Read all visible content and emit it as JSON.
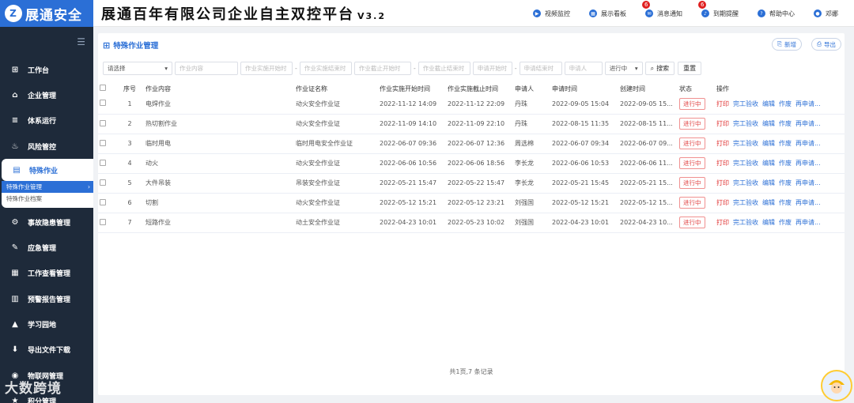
{
  "app": {
    "logo_text": "展通安全",
    "title": "展通百年有限公司企业自主双控平台",
    "version": "V3.2"
  },
  "topnav": [
    {
      "label": "视频监控",
      "icon": "video-icon",
      "badge": ""
    },
    {
      "label": "展示看板",
      "icon": "dashboard-icon",
      "badge": ""
    },
    {
      "label": "消息通知",
      "icon": "message-icon",
      "badge": "6"
    },
    {
      "label": "到期提醒",
      "icon": "bell-icon",
      "badge": "6"
    },
    {
      "label": "帮助中心",
      "icon": "help-icon",
      "badge": ""
    },
    {
      "label": "邓娜",
      "icon": "user-icon",
      "badge": ""
    }
  ],
  "sidebar": {
    "items": [
      {
        "label": "工作台",
        "icon": "windows-icon"
      },
      {
        "label": "企业管理",
        "icon": "home-icon"
      },
      {
        "label": "体系运行",
        "icon": "stack-icon"
      },
      {
        "label": "风险管控",
        "icon": "fire-icon"
      },
      {
        "label": "特殊作业",
        "icon": "document-icon"
      },
      {
        "label": "事故隐患管理",
        "icon": "gear-icon"
      },
      {
        "label": "应急管理",
        "icon": "edit-icon"
      },
      {
        "label": "工作查看管理",
        "icon": "calendar-icon"
      },
      {
        "label": "预警报告管理",
        "icon": "report-icon"
      },
      {
        "label": "学习园地",
        "icon": "graduation-icon"
      },
      {
        "label": "导出文件下载",
        "icon": "download-icon"
      },
      {
        "label": "物联网管理",
        "icon": "iot-icon"
      },
      {
        "label": "积分管理",
        "icon": "points-icon"
      }
    ],
    "sub_items": [
      {
        "label": "特殊作业管理"
      },
      {
        "label": "特殊作业档案"
      }
    ],
    "watermark": "大数跨境"
  },
  "panel": {
    "title": "特殊作业管理",
    "add_label": "新增",
    "export_label": "导出"
  },
  "filters": {
    "select_placeholder": "请选择",
    "content": "作业内容",
    "start_from": "作业实施开始时",
    "start_to": "作业实施结束时",
    "end_from": "作业截止开始时",
    "end_to": "作业截止结束时",
    "apply_from": "申请开始时",
    "apply_to": "申请结束时",
    "applicant": "申请人",
    "status": "进行中",
    "search_label": "搜索",
    "reset_label": "重置"
  },
  "table": {
    "headers": [
      "序号",
      "作业内容",
      "作业证名称",
      "作业实施开始时间",
      "作业实施截止时间",
      "申请人",
      "申请时间",
      "创建时间",
      "状态",
      "操作"
    ],
    "rows": [
      {
        "no": "1",
        "content": "电焊作业",
        "cert": "动火安全作业证",
        "start": "2022-11-12 14:09",
        "end": "2022-11-12 22:09",
        "applicant": "丹珠",
        "apply": "2022-09-05 15:04",
        "created": "2022-09-05 15...",
        "status": "进行中"
      },
      {
        "no": "2",
        "content": "热切割作业",
        "cert": "动火安全作业证",
        "start": "2022-11-09 14:10",
        "end": "2022-11-09 22:10",
        "applicant": "丹珠",
        "apply": "2022-08-15 11:35",
        "created": "2022-08-15 11...",
        "status": "进行中"
      },
      {
        "no": "3",
        "content": "临时用电",
        "cert": "临时用电安全作业证",
        "start": "2022-06-07 09:36",
        "end": "2022-06-07 12:36",
        "applicant": "周选棉",
        "apply": "2022-06-07 09:34",
        "created": "2022-06-07 09...",
        "status": "进行中"
      },
      {
        "no": "4",
        "content": "动火",
        "cert": "动火安全作业证",
        "start": "2022-06-06 10:56",
        "end": "2022-06-06 18:56",
        "applicant": "李长龙",
        "apply": "2022-06-06 10:53",
        "created": "2022-06-06 11...",
        "status": "进行中"
      },
      {
        "no": "5",
        "content": "大件吊装",
        "cert": "吊装安全作业证",
        "start": "2022-05-21 15:47",
        "end": "2022-05-22 15:47",
        "applicant": "李长龙",
        "apply": "2022-05-21 15:45",
        "created": "2022-05-21 15...",
        "status": "进行中"
      },
      {
        "no": "6",
        "content": "切割",
        "cert": "动火安全作业证",
        "start": "2022-05-12 15:21",
        "end": "2022-05-12 23:21",
        "applicant": "刘强国",
        "apply": "2022-05-12 15:21",
        "created": "2022-05-12 15...",
        "status": "进行中"
      },
      {
        "no": "7",
        "content": "短路作业",
        "cert": "动土安全作业证",
        "start": "2022-04-23 10:01",
        "end": "2022-05-23 10:02",
        "applicant": "刘强国",
        "apply": "2022-04-23 10:01",
        "created": "2022-04-23 10...",
        "status": "进行中"
      }
    ],
    "actions": [
      "打印",
      "完工验收",
      "编辑",
      "作废",
      "再申请..."
    ]
  },
  "pagination": {
    "summary": "共1页,7 条记录"
  }
}
